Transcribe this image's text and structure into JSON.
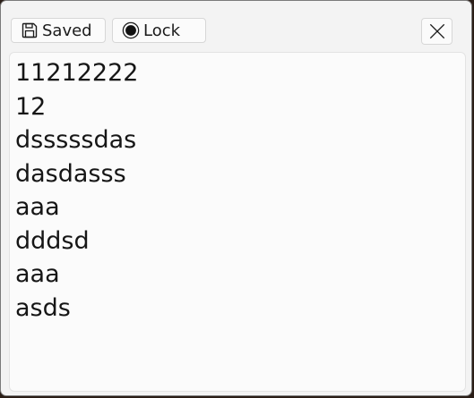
{
  "toolbar": {
    "saved_label": "Saved",
    "lock_label": "Lock",
    "saved_icon": "floppy-disk-icon",
    "lock_icon": "record-dot-icon",
    "close_icon": "close-x-icon"
  },
  "editor": {
    "lines": [
      "11212222",
      "12",
      "dsssssdas",
      "dasdasss",
      "aaa",
      "dddsd",
      "aaa",
      "asds"
    ]
  }
}
